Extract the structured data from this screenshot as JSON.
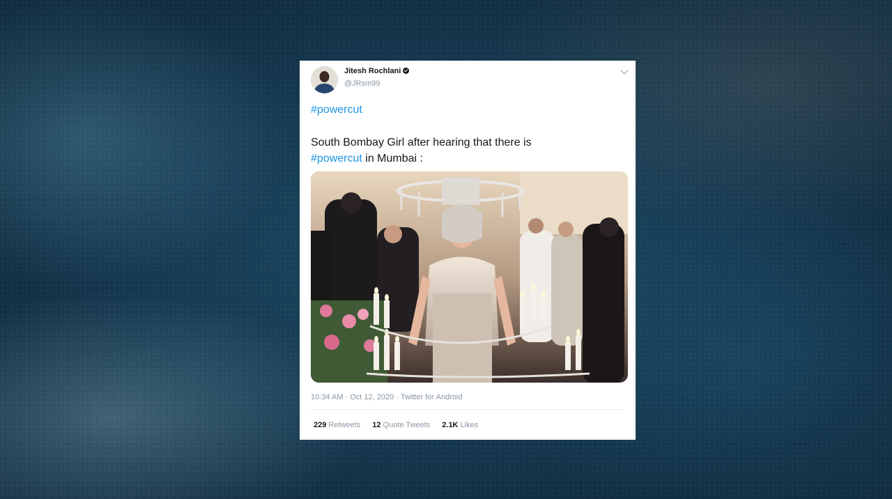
{
  "tweet": {
    "display_name": "Jitesh Rochlani",
    "handle": "@JRsm99",
    "hashtag": "#powercut",
    "text_line2": "South Bombay Girl after hearing that there is",
    "text_line3_suffix": " in Mumbai :",
    "timestamp": "10:34 AM · Oct 12, 2020 · Twitter for Android",
    "stats": {
      "retweets_count": "229",
      "retweets_label": "Retweets",
      "quotes_count": "12",
      "quotes_label": "Quote Tweets",
      "likes_count": "2.1K",
      "likes_label": "Likes"
    }
  },
  "colors": {
    "link": "#1b95e0",
    "text": "#14171a",
    "muted": "#8a96a1",
    "card": "#ffffff"
  },
  "icons": [
    "verified-icon",
    "chevron-down-icon"
  ]
}
